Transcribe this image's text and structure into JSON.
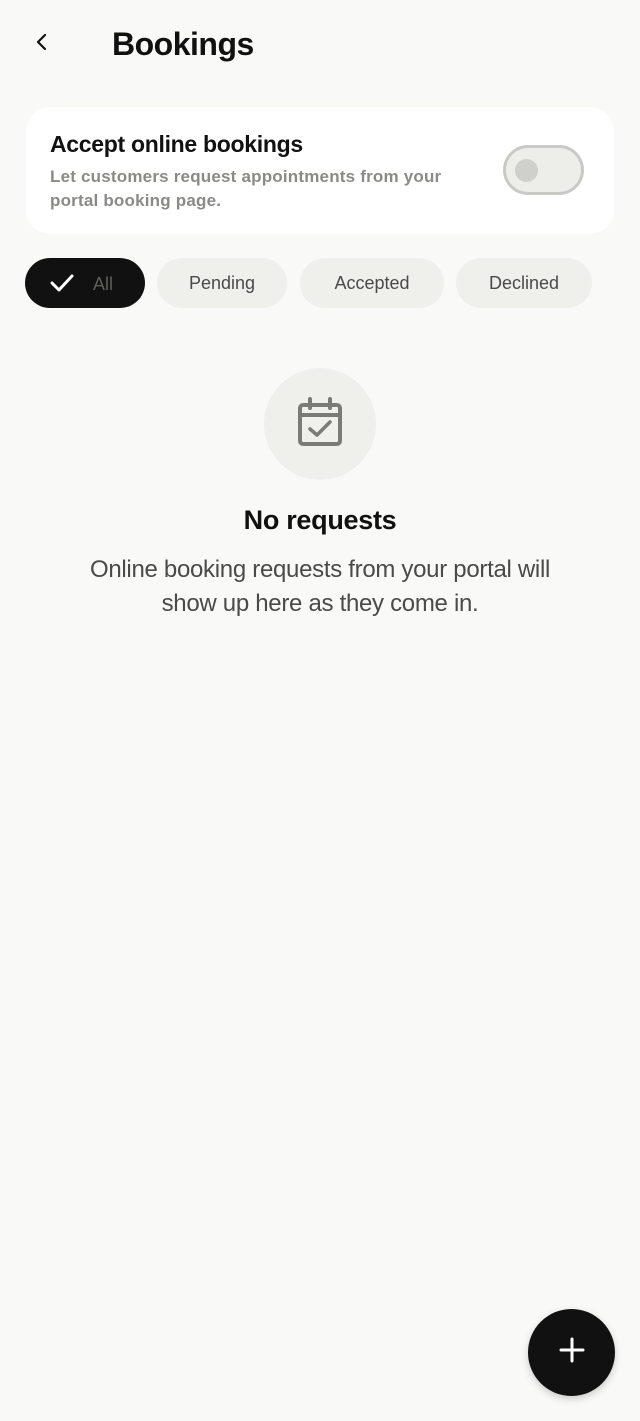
{
  "header": {
    "back_icon": "chevron-left-icon",
    "title": "Bookings"
  },
  "settings_card": {
    "title": "Accept online bookings",
    "description": "Let customers request appointments from your portal booking page.",
    "toggle_enabled": false
  },
  "filters": {
    "selected": "All",
    "chips": [
      {
        "label": "All",
        "icon": "check-icon"
      },
      {
        "label": "Pending"
      },
      {
        "label": "Accepted"
      },
      {
        "label": "Declined"
      }
    ]
  },
  "empty_state": {
    "icon": "calendar-check-icon",
    "title": "No requests",
    "description": "Online booking requests from your portal will show up here as they come in."
  },
  "fab": {
    "icon": "plus-icon"
  },
  "colors": {
    "background": "#f9f9f7",
    "card": "#ffffff",
    "primary": "#111111",
    "chip": "#efefec",
    "muted_text": "#8a8a86"
  }
}
